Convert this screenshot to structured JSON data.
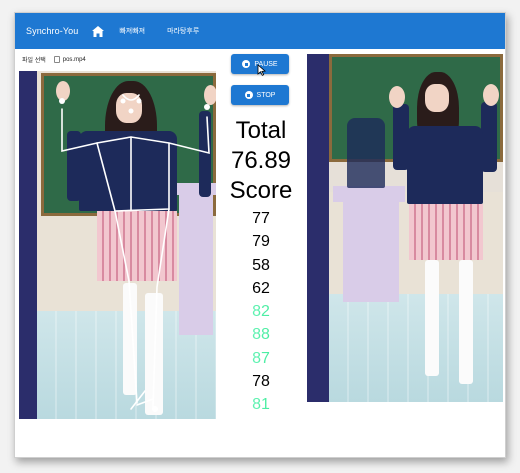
{
  "app": {
    "title": "Synchro-You",
    "nav": [
      "빠져빠져",
      "마라탕후루"
    ]
  },
  "file": {
    "pick_label": "파일 선택",
    "filename": "pos.mp4"
  },
  "controls": {
    "pause_label": "PAUSE",
    "stop_label": "STOP"
  },
  "score": {
    "total_label": "Total",
    "total_value": "76.89",
    "score_label": "Score",
    "list": [
      "77",
      "79",
      "58",
      "62",
      "82",
      "88",
      "87",
      "78",
      "81"
    ],
    "highlight": [
      false,
      false,
      false,
      false,
      true,
      true,
      true,
      false,
      true
    ]
  },
  "colors": {
    "accent": "#1e78d2",
    "good_score_from": "#8fffd8",
    "good_score_to": "#18e07a"
  }
}
